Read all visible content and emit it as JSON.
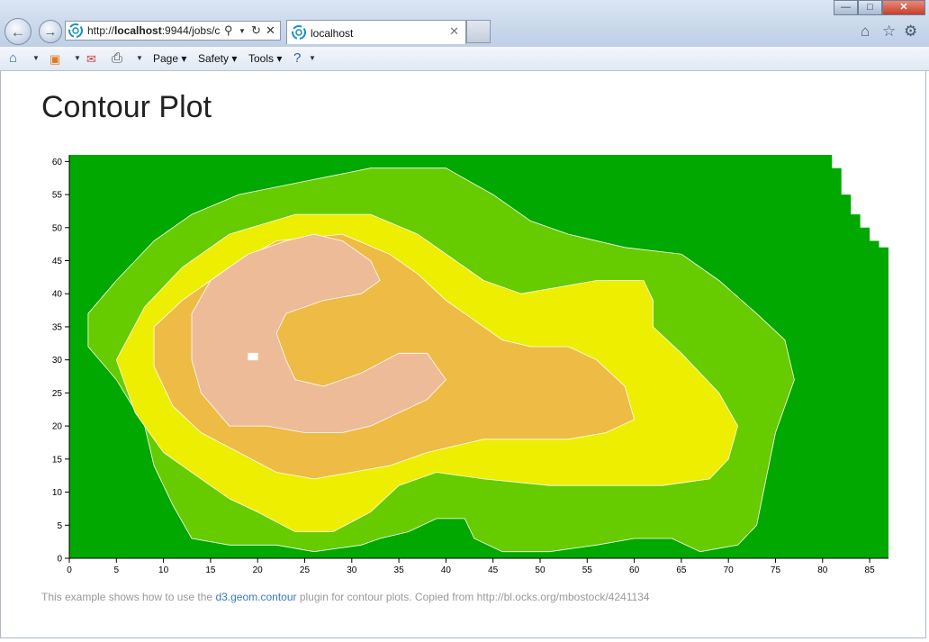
{
  "browser": {
    "url": "http://localhost:9944/jobs/c",
    "url_host": "localhost",
    "url_prefix": "http://",
    "url_suffix": ":9944/jobs/c",
    "tab_title": "localhost",
    "window_buttons": {
      "minimize": "—",
      "maximize": "□",
      "close": "✕"
    }
  },
  "commandbar": {
    "page": "Page",
    "safety": "Safety",
    "tools": "Tools"
  },
  "page": {
    "title": "Contour Plot",
    "caption_prefix": "This example shows how to use the ",
    "caption_link": "d3.geom.contour",
    "caption_suffix": " plugin for contour plots. Copied from http://bl.ocks.org/mbostock/4241134"
  },
  "colors": {
    "level1": "#00a800",
    "level2": "#66cc00",
    "level3": "#eeee00",
    "level4": "#eebb44",
    "level5": "#eebb99",
    "peak": "#ffffff"
  },
  "chart_data": {
    "type": "heatmap",
    "xlim": [
      0,
      87
    ],
    "ylim": [
      0,
      61
    ],
    "x_ticks": [
      0,
      5,
      10,
      15,
      20,
      25,
      30,
      35,
      40,
      45,
      50,
      55,
      60,
      65,
      70,
      75,
      80,
      85
    ],
    "y_ticks": [
      0,
      5,
      10,
      15,
      20,
      25,
      30,
      35,
      40,
      45,
      50,
      55,
      60
    ],
    "grid": false,
    "legend": "none",
    "levels": [
      {
        "level": 1,
        "color": "#00a800",
        "outline": [
          [
            0,
            0
          ],
          [
            87,
            0
          ],
          [
            87,
            47
          ],
          [
            86,
            47
          ],
          [
            86,
            48
          ],
          [
            85,
            48
          ],
          [
            85,
            50
          ],
          [
            84,
            50
          ],
          [
            84,
            52
          ],
          [
            83,
            52
          ],
          [
            83,
            55
          ],
          [
            82,
            55
          ],
          [
            82,
            59
          ],
          [
            81,
            59
          ],
          [
            81,
            61
          ],
          [
            0,
            61
          ]
        ]
      },
      {
        "level": 2,
        "color": "#66cc00",
        "outline": [
          [
            13,
            3
          ],
          [
            17,
            2
          ],
          [
            22,
            2
          ],
          [
            26,
            1
          ],
          [
            31,
            2
          ],
          [
            33,
            3
          ],
          [
            36,
            4
          ],
          [
            39,
            6
          ],
          [
            42,
            6
          ],
          [
            43,
            3
          ],
          [
            46,
            1
          ],
          [
            51,
            1
          ],
          [
            56,
            2
          ],
          [
            60,
            3
          ],
          [
            64,
            3
          ],
          [
            67,
            1
          ],
          [
            71,
            2
          ],
          [
            73,
            5
          ],
          [
            74,
            12
          ],
          [
            75,
            19
          ],
          [
            77,
            27
          ],
          [
            76,
            33
          ],
          [
            73,
            37
          ],
          [
            69,
            42
          ],
          [
            65,
            46
          ],
          [
            59,
            47
          ],
          [
            53,
            49
          ],
          [
            49,
            51
          ],
          [
            45,
            55
          ],
          [
            40,
            59
          ],
          [
            32,
            59
          ],
          [
            25,
            57
          ],
          [
            18,
            55
          ],
          [
            13,
            52
          ],
          [
            9,
            48
          ],
          [
            5,
            42
          ],
          [
            2,
            37
          ],
          [
            2,
            32
          ],
          [
            5,
            27
          ],
          [
            8,
            20
          ],
          [
            9,
            14
          ],
          [
            11,
            8
          ]
        ]
      },
      {
        "level": 3,
        "color": "#eeee00",
        "outline": [
          [
            20,
            7
          ],
          [
            24,
            4
          ],
          [
            28,
            4
          ],
          [
            32,
            7
          ],
          [
            35,
            11
          ],
          [
            39,
            13
          ],
          [
            44,
            12
          ],
          [
            51,
            11
          ],
          [
            57,
            11
          ],
          [
            63,
            11
          ],
          [
            68,
            12
          ],
          [
            70,
            15
          ],
          [
            71,
            20
          ],
          [
            69,
            25
          ],
          [
            65,
            31
          ],
          [
            62,
            35
          ],
          [
            62,
            39
          ],
          [
            61,
            42
          ],
          [
            56,
            42
          ],
          [
            52,
            41
          ],
          [
            48,
            40
          ],
          [
            44,
            42
          ],
          [
            41,
            45
          ],
          [
            37,
            49
          ],
          [
            32,
            52
          ],
          [
            24,
            52
          ],
          [
            17,
            49
          ],
          [
            12,
            44
          ],
          [
            8,
            38
          ],
          [
            5,
            30
          ],
          [
            7,
            22
          ],
          [
            10,
            16
          ],
          [
            14,
            12
          ],
          [
            17,
            9
          ]
        ]
      },
      {
        "level": 4,
        "color": "#eebb44",
        "outline": [
          [
            22,
            13
          ],
          [
            26,
            12
          ],
          [
            30,
            13
          ],
          [
            34,
            14
          ],
          [
            38,
            16
          ],
          [
            44,
            18
          ],
          [
            48,
            18
          ],
          [
            53,
            18
          ],
          [
            57,
            19
          ],
          [
            60,
            21
          ],
          [
            59,
            26
          ],
          [
            56,
            30
          ],
          [
            53,
            32
          ],
          [
            49,
            32
          ],
          [
            46,
            33
          ],
          [
            43,
            36
          ],
          [
            40,
            39
          ],
          [
            37,
            43
          ],
          [
            34,
            46
          ],
          [
            29,
            49
          ],
          [
            22,
            48
          ],
          [
            17,
            44
          ],
          [
            12,
            39
          ],
          [
            9,
            35
          ],
          [
            9,
            29
          ],
          [
            11,
            23
          ],
          [
            14,
            19
          ],
          [
            18,
            16
          ]
        ]
      },
      {
        "level": 5,
        "color": "#eebb99",
        "outline": [
          [
            17,
            20
          ],
          [
            21,
            20
          ],
          [
            25,
            19
          ],
          [
            29,
            19
          ],
          [
            32,
            20
          ],
          [
            35,
            22
          ],
          [
            38,
            24
          ],
          [
            40,
            27
          ],
          [
            38,
            31
          ],
          [
            35,
            31
          ],
          [
            31,
            28
          ],
          [
            27,
            26
          ],
          [
            24,
            27
          ],
          [
            23,
            30
          ],
          [
            22,
            34
          ],
          [
            23,
            37
          ],
          [
            27,
            39
          ],
          [
            31,
            40
          ],
          [
            33,
            42
          ],
          [
            32,
            45
          ],
          [
            29,
            48
          ],
          [
            26,
            49
          ],
          [
            23,
            48
          ],
          [
            19,
            46
          ],
          [
            15,
            42
          ],
          [
            13,
            37
          ],
          [
            13,
            30
          ],
          [
            14,
            25
          ]
        ]
      },
      {
        "level": 6,
        "color": "#ffffff",
        "outline": [
          [
            19,
            30
          ],
          [
            20,
            30
          ],
          [
            20,
            31
          ],
          [
            19,
            31
          ]
        ]
      }
    ]
  }
}
